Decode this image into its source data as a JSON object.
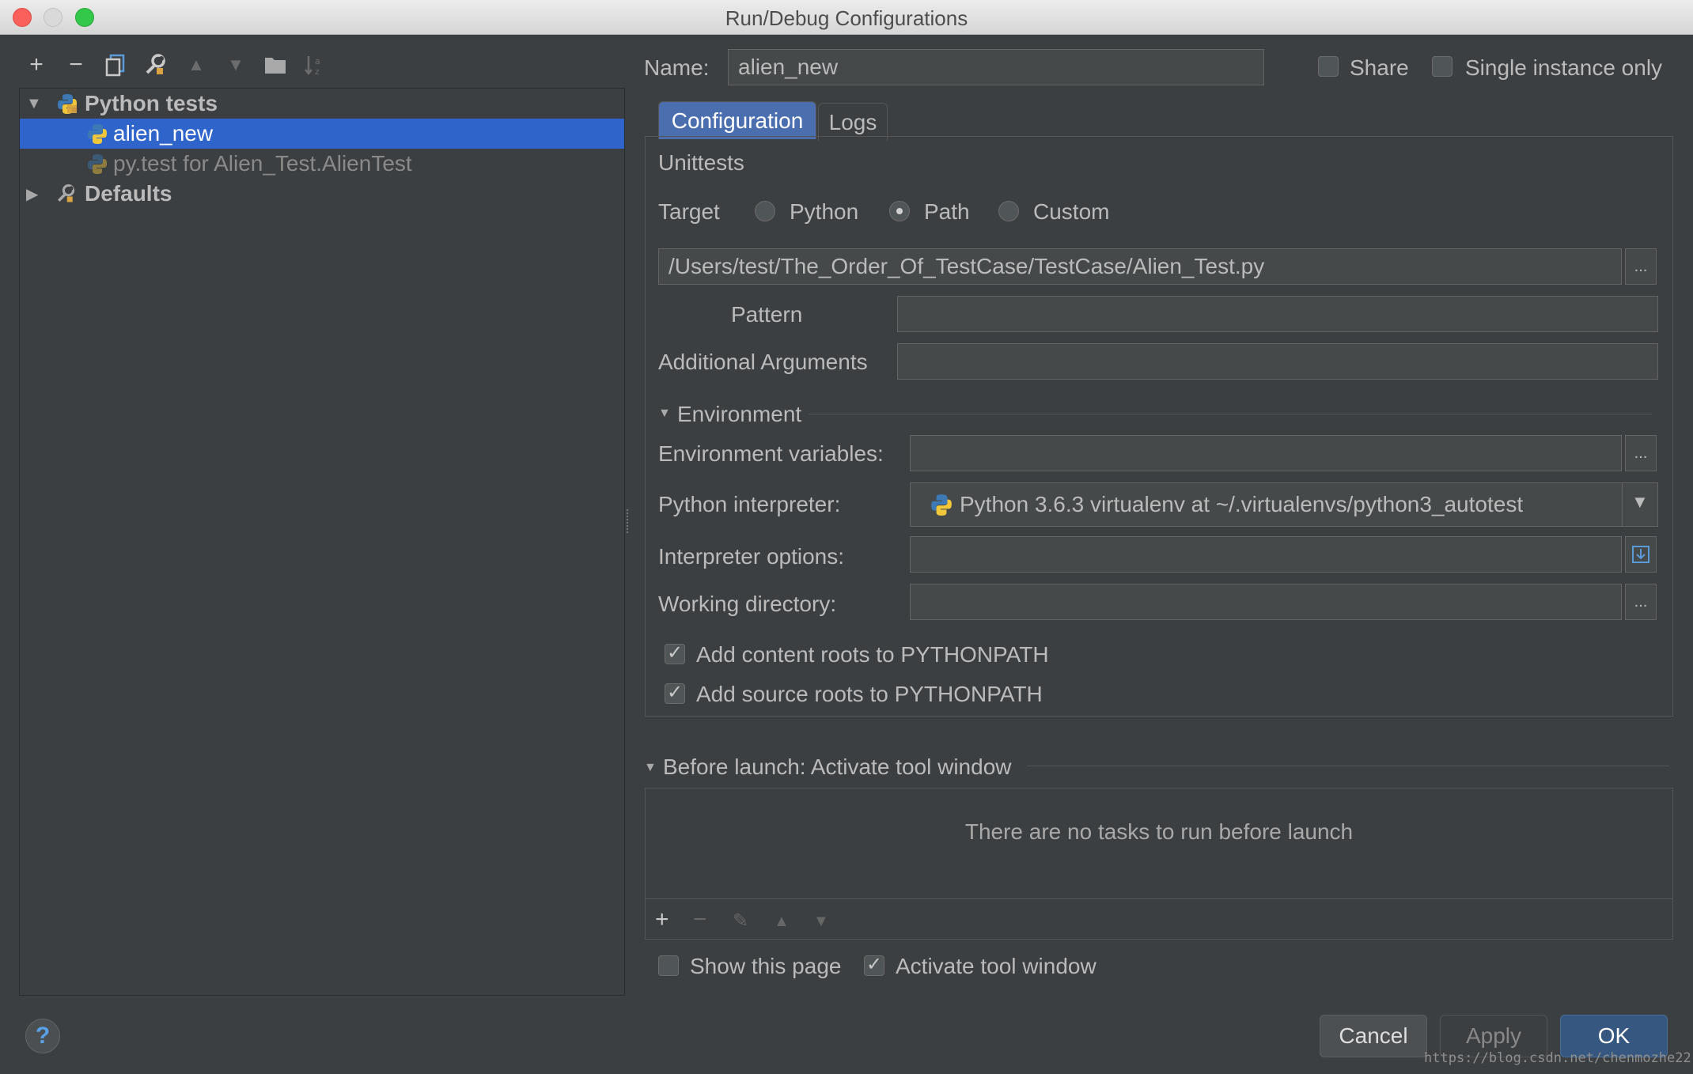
{
  "window": {
    "title": "Run/Debug Configurations"
  },
  "tree": {
    "items": [
      {
        "label": "Python tests",
        "icon": "python-icon",
        "expanded": true
      },
      {
        "label": "alien_new",
        "icon": "python-test-icon",
        "selected": true
      },
      {
        "label": "py.test for Alien_Test.AlienTest",
        "icon": "python-test-icon"
      },
      {
        "label": "Defaults",
        "icon": "wrench-icon",
        "expanded": false
      }
    ]
  },
  "toolbar": {
    "add": "+",
    "remove": "−",
    "copy": "copy-icon",
    "edit_defaults": "wrench-icon",
    "move_up": "▲",
    "move_down": "▼",
    "folder": "folder-icon",
    "sort": "sort-icon"
  },
  "header": {
    "name_label": "Name:",
    "name_value": "alien_new",
    "share_label": "Share",
    "share_checked": false,
    "single_instance_label": "Single instance only",
    "single_instance_checked": false
  },
  "tabs": [
    {
      "label": "Configuration",
      "active": true
    },
    {
      "label": "Logs",
      "active": false
    }
  ],
  "config": {
    "section_title": "Unittests",
    "target_label": "Target",
    "target_options": [
      "Python",
      "Path",
      "Custom"
    ],
    "target_selected": "Path",
    "path_value": "/Users/test/The_Order_Of_TestCase/TestCase/Alien_Test.py",
    "pattern_label": "Pattern",
    "pattern_value": "",
    "additional_args_label": "Additional Arguments",
    "additional_args_value": "",
    "environment_title": "Environment",
    "env_vars_label": "Environment variables:",
    "env_vars_value": "",
    "interpreter_label": "Python interpreter:",
    "interpreter_value": "Python 3.6.3 virtualenv at ~/.virtualenvs/python3_autotest",
    "interp_options_label": "Interpreter options:",
    "interp_options_value": "",
    "working_dir_label": "Working directory:",
    "working_dir_value": "",
    "content_roots_label": "Add content roots to PYTHONPATH",
    "content_roots_checked": true,
    "source_roots_label": "Add source roots to PYTHONPATH",
    "source_roots_checked": true,
    "browse_label": "..."
  },
  "before_launch": {
    "title": "Before launch: Activate tool window",
    "empty_text": "There are no tasks to run before launch",
    "show_page_label": "Show this page",
    "show_page_checked": false,
    "activate_label": "Activate tool window",
    "activate_checked": true
  },
  "buttons": {
    "help": "?",
    "cancel": "Cancel",
    "apply": "Apply",
    "ok": "OK"
  },
  "watermark": "https://blog.csdn.net/chenmozhe22",
  "colors": {
    "selection": "#2f65ca",
    "tab_active": "#4b6eaf",
    "ok_button": "#365880",
    "background": "#3c3f41"
  }
}
